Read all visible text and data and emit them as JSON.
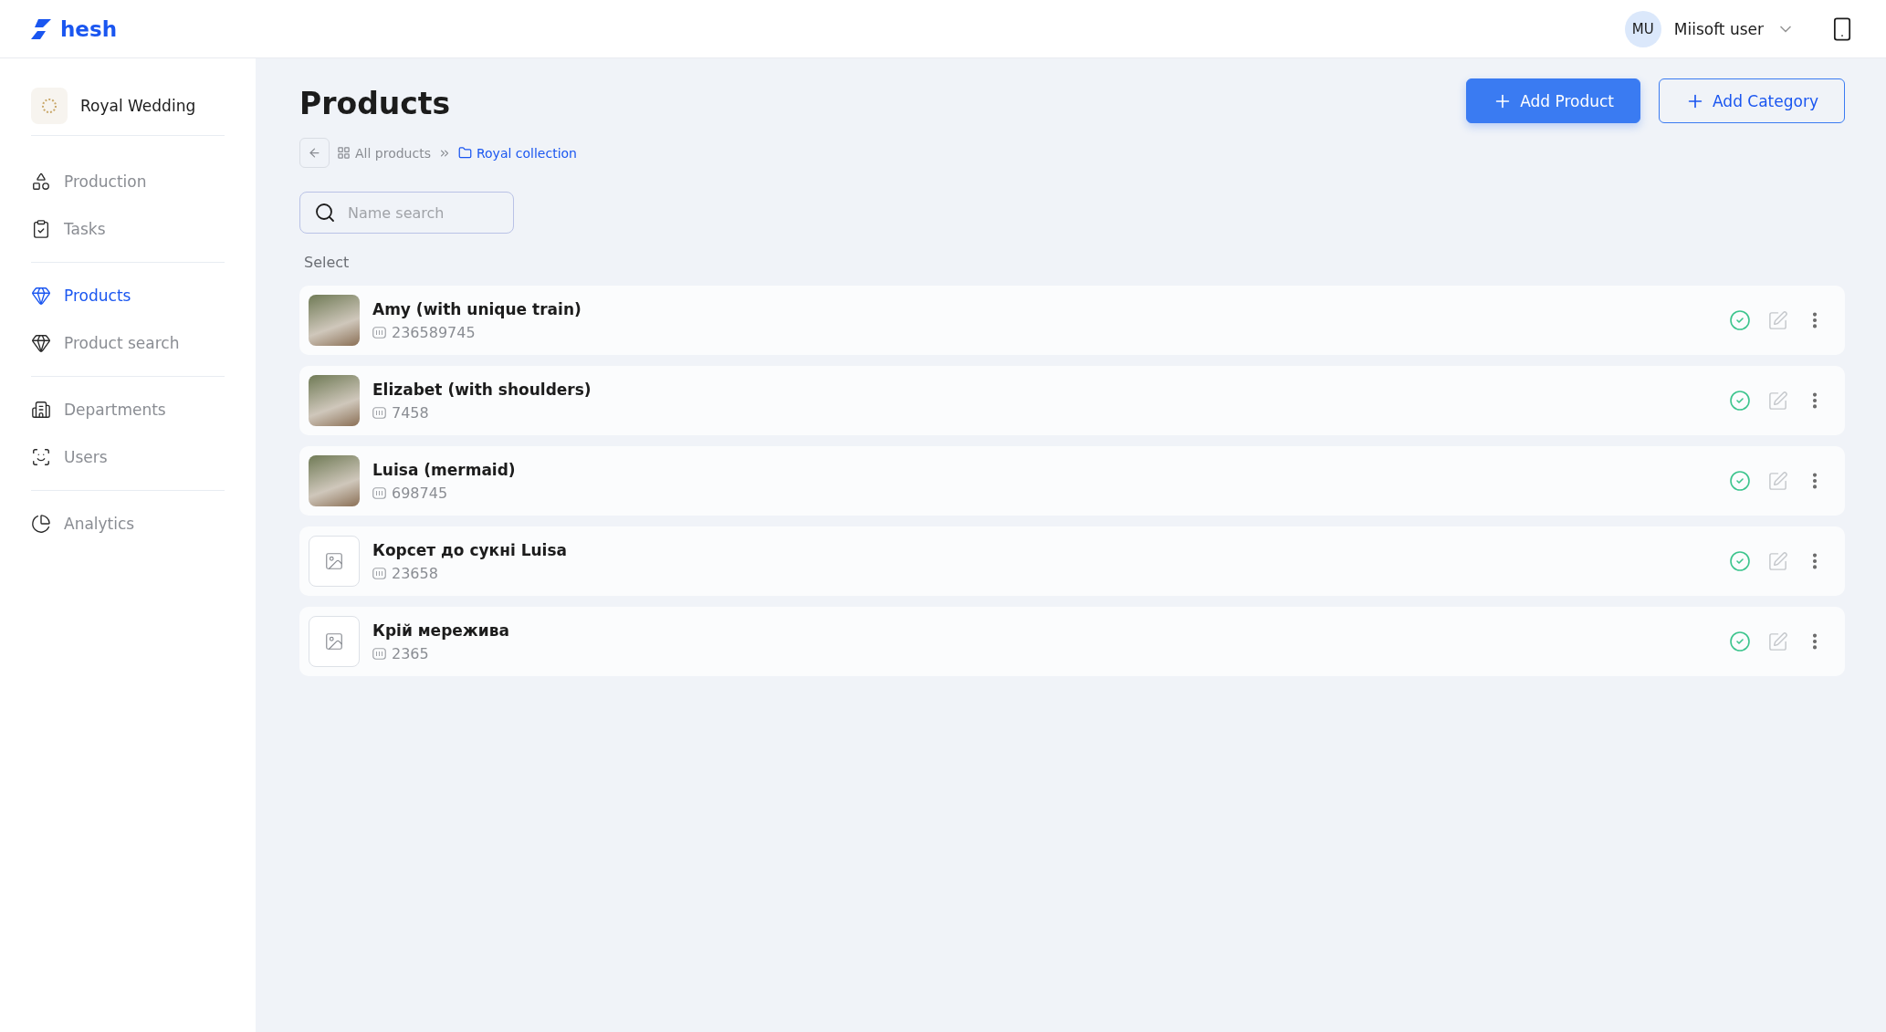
{
  "brand": {
    "name": "hesh"
  },
  "user": {
    "initials": "MU",
    "name": "Miisoft user"
  },
  "workspace": {
    "name": "Royal Wedding"
  },
  "sidebar": {
    "groups": [
      {
        "items": [
          {
            "label": "Production",
            "selected": false
          },
          {
            "label": "Tasks",
            "selected": false
          }
        ]
      },
      {
        "items": [
          {
            "label": "Products",
            "selected": true
          },
          {
            "label": "Product search",
            "selected": false
          }
        ]
      },
      {
        "items": [
          {
            "label": "Departments",
            "selected": false
          },
          {
            "label": "Users",
            "selected": false
          }
        ]
      },
      {
        "items": [
          {
            "label": "Analytics",
            "selected": false
          }
        ]
      }
    ]
  },
  "page": {
    "title": "Products",
    "buttons": [
      {
        "kind": "primary",
        "label": "Add Product"
      },
      {
        "kind": "outline",
        "label": "Add Category"
      }
    ]
  },
  "breadcrumb": [
    {
      "kind": "grid",
      "label": "All products",
      "current": false
    },
    {
      "kind": "folder",
      "label": "Royal collection",
      "current": true
    }
  ],
  "search": {
    "placeholder": "Name search"
  },
  "select_label": "Select",
  "products": [
    {
      "kind": "photo",
      "name": "Amy (with unique train)",
      "code": "236589745",
      "active": true
    },
    {
      "kind": "photo",
      "name": "Elizabet (with shoulders)",
      "code": "7458",
      "active": true
    },
    {
      "kind": "photo",
      "name": "Luisa (mermaid)",
      "code": "698745",
      "active": true
    },
    {
      "kind": "placeholder",
      "name": "Корсет до сукні Luisa",
      "code": "23658",
      "active": true
    },
    {
      "kind": "placeholder",
      "name": "Крій мережива",
      "code": "2365",
      "active": true
    }
  ]
}
